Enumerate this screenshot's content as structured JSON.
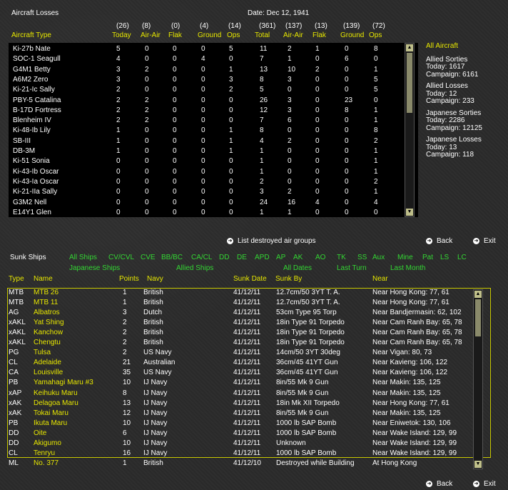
{
  "title": "Aircraft Losses",
  "date": "Date: Dec 12, 1941",
  "losses_header": {
    "totals": [
      "(26)",
      "(8)",
      "(0)",
      "(4)",
      "(14)",
      "(361)",
      "(137)",
      "(13)",
      "(139)",
      "(72)"
    ],
    "labels": [
      "Today",
      "Air-Air",
      "Flak",
      "Ground",
      "Ops",
      "Total",
      "Air-Air",
      "Flak",
      "Ground",
      "Ops"
    ],
    "type_label": "Aircraft Type"
  },
  "aircraft_rows": [
    [
      "Ki-27b Nate",
      "5",
      "0",
      "0",
      "0",
      "5",
      "11",
      "2",
      "1",
      "0",
      "8"
    ],
    [
      "SOC-1 Seagull",
      "4",
      "0",
      "0",
      "4",
      "0",
      "7",
      "1",
      "0",
      "6",
      "0"
    ],
    [
      "G4M1 Betty",
      "3",
      "2",
      "0",
      "0",
      "1",
      "13",
      "10",
      "2",
      "0",
      "1"
    ],
    [
      "A6M2 Zero",
      "3",
      "0",
      "0",
      "0",
      "3",
      "8",
      "3",
      "0",
      "0",
      "5"
    ],
    [
      "Ki-21-Ic Sally",
      "2",
      "0",
      "0",
      "0",
      "2",
      "5",
      "0",
      "0",
      "0",
      "5"
    ],
    [
      "PBY-5 Catalina",
      "2",
      "2",
      "0",
      "0",
      "0",
      "26",
      "3",
      "0",
      "23",
      "0"
    ],
    [
      "B-17D Fortress",
      "2",
      "2",
      "0",
      "0",
      "0",
      "12",
      "3",
      "0",
      "8",
      "1"
    ],
    [
      "Blenheim IV",
      "2",
      "2",
      "0",
      "0",
      "0",
      "7",
      "6",
      "0",
      "0",
      "1"
    ],
    [
      "Ki-48-Ib Lily",
      "1",
      "0",
      "0",
      "0",
      "1",
      "8",
      "0",
      "0",
      "0",
      "8"
    ],
    [
      "SB-III",
      "1",
      "0",
      "0",
      "0",
      "1",
      "4",
      "2",
      "0",
      "0",
      "2"
    ],
    [
      "DB-3M",
      "1",
      "0",
      "0",
      "0",
      "1",
      "1",
      "0",
      "0",
      "0",
      "1"
    ],
    [
      "Ki-51 Sonia",
      "0",
      "0",
      "0",
      "0",
      "0",
      "1",
      "0",
      "0",
      "0",
      "1"
    ],
    [
      "Ki-43-Ib Oscar",
      "0",
      "0",
      "0",
      "0",
      "0",
      "1",
      "0",
      "0",
      "0",
      "1"
    ],
    [
      "Ki-43-Ia Oscar",
      "0",
      "0",
      "0",
      "0",
      "0",
      "2",
      "0",
      "0",
      "0",
      "2"
    ],
    [
      "Ki-21-IIa Sally",
      "0",
      "0",
      "0",
      "0",
      "0",
      "3",
      "2",
      "0",
      "0",
      "1"
    ],
    [
      "G3M2 Nell",
      "0",
      "0",
      "0",
      "0",
      "0",
      "24",
      "16",
      "4",
      "0",
      "4"
    ],
    [
      "E14Y1 Glen",
      "0",
      "0",
      "0",
      "0",
      "0",
      "1",
      "1",
      "0",
      "0",
      "0"
    ]
  ],
  "summary": {
    "heading": "All Aircraft",
    "allied_sorties": [
      "Allied Sorties",
      "Today:   1617",
      "Campaign: 6161"
    ],
    "allied_losses": [
      "Allied Losses",
      "Today:   12",
      "Campaign: 233"
    ],
    "japanese_sorties": [
      "Japanese Sorties",
      "Today:   2286",
      "Campaign: 12125"
    ],
    "japanese_losses": [
      "Japanese Losses",
      "Today:   13",
      "Campaign: 118"
    ]
  },
  "list_destroyed": "List destroyed air groups",
  "back": "Back",
  "exit": "Exit",
  "sunk_title": "Sunk Ships",
  "filters_row1": [
    "All Ships",
    "CV/CVL",
    "CVE",
    "BB/BC",
    "CA/CL",
    "DD",
    "DE",
    "APD",
    "AP",
    "AK",
    "AO",
    "TK",
    "SS",
    "Aux",
    "Mine",
    "Pat",
    "LS",
    "LC"
  ],
  "filters_row2": [
    "Japanese Ships",
    "Allied Ships",
    "All Dates",
    "Last Turn",
    "Last Month"
  ],
  "ship_header": [
    "Type",
    "Name",
    "Points",
    "Navy",
    "Sunk Date",
    "Sunk By",
    "Near"
  ],
  "ship_rows": [
    [
      "MTB",
      "MTB 26",
      "1",
      "British",
      "41/12/11",
      "12.7cm/50 3YT T. A.",
      "Near Hong Kong: 77, 61"
    ],
    [
      "MTB",
      "MTB 11",
      "1",
      "British",
      "41/12/11",
      "12.7cm/50 3YT T. A.",
      "Near Hong Kong: 77, 61"
    ],
    [
      "AG",
      "Albatros",
      "3",
      "Dutch",
      "41/12/11",
      "53cm Type 95 Torp",
      "Near Bandjermasin: 62, 102"
    ],
    [
      "xAKL",
      "Yat Shing",
      "2",
      "British",
      "41/12/11",
      "18in Type 91 Torpedo",
      "Near Cam Ranh Bay: 65, 78"
    ],
    [
      "xAKL",
      "Kanchow",
      "2",
      "British",
      "41/12/11",
      "18in Type 91 Torpedo",
      "Near Cam Ranh Bay: 65, 78"
    ],
    [
      "xAKL",
      "Chengtu",
      "2",
      "British",
      "41/12/11",
      "18in Type 91 Torpedo",
      "Near Cam Ranh Bay: 65, 78"
    ],
    [
      "PG",
      "Tulsa",
      "2",
      "US Navy",
      "41/12/11",
      "14cm/50 3YT 30deg",
      "Near Vigan: 80, 73"
    ],
    [
      "CL",
      "Adelaide",
      "21",
      "Australian",
      "41/12/11",
      "36cm/45 41YT Gun",
      "Near Kavieng: 106, 122"
    ],
    [
      "CA",
      "Louisville",
      "35",
      "US Navy",
      "41/12/11",
      "36cm/45 41YT Gun",
      "Near Kavieng: 106, 122"
    ],
    [
      "PB",
      "Yamahagi Maru #3",
      "10",
      "IJ Navy",
      "41/12/11",
      "8in/55 Mk 9 Gun",
      "Near Makin: 135, 125"
    ],
    [
      "xAP",
      "Keihuku Maru",
      "8",
      "IJ Navy",
      "41/12/11",
      "8in/55 Mk 9 Gun",
      "Near Makin: 135, 125"
    ],
    [
      "xAK",
      "Delagoa Maru",
      "13",
      "IJ Navy",
      "41/12/11",
      "18in Mk XII Torpedo",
      "Near Hong Kong: 77, 61"
    ],
    [
      "xAK",
      "Tokai Maru",
      "12",
      "IJ Navy",
      "41/12/11",
      "8in/55 Mk 9 Gun",
      "Near Makin: 135, 125"
    ],
    [
      "PB",
      "Ikuta Maru",
      "10",
      "IJ Navy",
      "41/12/11",
      "1000 lb SAP Bomb",
      "Near Eniwetok: 130, 106"
    ],
    [
      "DD",
      "Oite",
      "6",
      "IJ Navy",
      "41/12/11",
      "1000 lb SAP Bomb",
      "Near Wake Island: 129, 99"
    ],
    [
      "DD",
      "Akigumo",
      "10",
      "IJ Navy",
      "41/12/11",
      "Unknown",
      "Near Wake Island: 129, 99"
    ],
    [
      "CL",
      "Tenryu",
      "16",
      "IJ Navy",
      "41/12/11",
      "1000 lb SAP Bomb",
      "Near Wake Island: 129, 99"
    ],
    [
      "ML",
      "No. 377",
      "1",
      "British",
      "41/12/10",
      "Destroyed while Building",
      "At Hong Kong"
    ]
  ]
}
